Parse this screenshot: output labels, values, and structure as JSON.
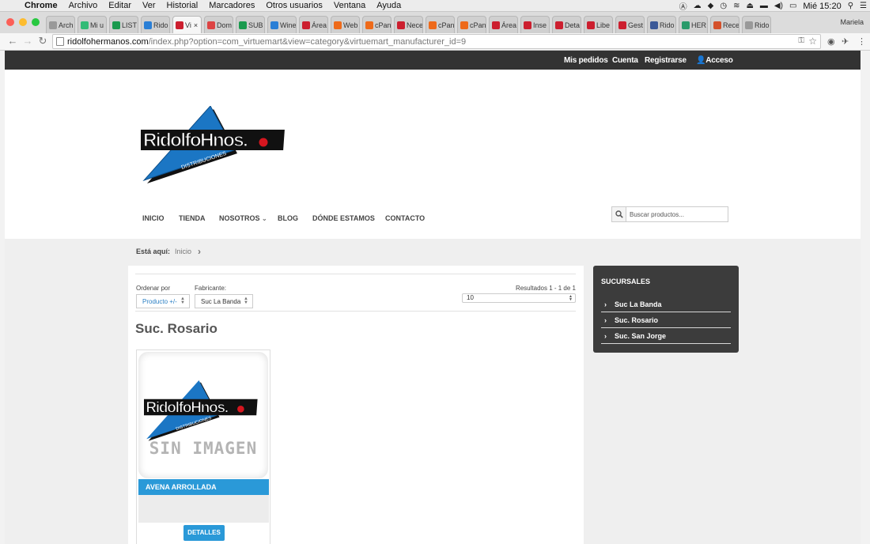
{
  "os_menubar": {
    "app": "Chrome",
    "items": [
      "Archivo",
      "Editar",
      "Ver",
      "Historial",
      "Marcadores",
      "Otros usuarios",
      "Ventana",
      "Ayuda"
    ],
    "clock": "Mié 15:20"
  },
  "browser": {
    "profile_name": "Mariela",
    "tabs": [
      {
        "label": "Arch",
        "fav": "#999"
      },
      {
        "label": "Mi u",
        "fav": "#3b7"
      },
      {
        "label": "LIST",
        "fav": "#1a9a4e"
      },
      {
        "label": "Rido",
        "fav": "#2a7fd6"
      },
      {
        "label": "Vi",
        "fav": "#cc1f2f",
        "active": true
      },
      {
        "label": "Dom",
        "fav": "#d44"
      },
      {
        "label": "SUB",
        "fav": "#1a9a4e"
      },
      {
        "label": "Wine",
        "fav": "#2a7fd6"
      },
      {
        "label": "Área",
        "fav": "#cc1f2f"
      },
      {
        "label": "Web",
        "fav": "#ee6a1a"
      },
      {
        "label": "cPan",
        "fav": "#ee6a1a"
      },
      {
        "label": "Nece",
        "fav": "#cc1f2f"
      },
      {
        "label": "cPan",
        "fav": "#ee6a1a"
      },
      {
        "label": "cPan",
        "fav": "#ee6a1a"
      },
      {
        "label": "Área",
        "fav": "#cc1f2f"
      },
      {
        "label": "Inse",
        "fav": "#cc1f2f"
      },
      {
        "label": "Deta",
        "fav": "#cc1f2f"
      },
      {
        "label": "Libe",
        "fav": "#cc1f2f"
      },
      {
        "label": "Gest",
        "fav": "#cc1f2f"
      },
      {
        "label": "Rido",
        "fav": "#3b5998"
      },
      {
        "label": "HER",
        "fav": "#2a9a6a"
      },
      {
        "label": "Rece",
        "fav": "#d4502a"
      },
      {
        "label": "Rido",
        "fav": "#999"
      }
    ],
    "url_domain": "ridolfohermanos.com",
    "url_path": "/index.php?option=com_virtuemart&view=category&virtuemart_manufacturer_id=9"
  },
  "site": {
    "topbar": {
      "orders": "Mis pedidos",
      "account": "Cuenta",
      "register": "Registrarse",
      "login": "Acceso"
    },
    "logo": {
      "brand": "RidolfoHnos.",
      "sub": "DISTRIBUCIONES"
    },
    "nav": {
      "inicio": "INICIO",
      "tienda": "TIENDA",
      "nosotros": "NOSOTROS",
      "blog": "BLOG",
      "donde": "DÓNDE ESTAMOS",
      "contacto": "CONTACTO"
    },
    "search_placeholder": "Buscar productos...",
    "breadcrumb": {
      "label": "Está aquí:",
      "home": "Inicio"
    },
    "listing": {
      "order_label": "Ordenar por",
      "order_value": "Producto +/-",
      "manufacturer_label": "Fabricante:",
      "manufacturer_value": "Suc La Banda",
      "results": "Resultados 1 - 1 de 1",
      "per_page": "10",
      "category_title": "Suc. Rosario"
    },
    "product": {
      "placeholder_text": "SIN IMAGEN",
      "name": "AVENA ARROLLADA",
      "details_label": "DETALLES"
    },
    "sidebar": {
      "title": "SUCURSALES",
      "items": [
        "Suc La Banda",
        "Suc. Rosario",
        "Suc. San Jorge"
      ]
    },
    "colors": {
      "accent_blue": "#2a99d8",
      "logo_blue": "#1b76c4",
      "topbar": "#333333",
      "logo_red": "#d6161f"
    }
  }
}
